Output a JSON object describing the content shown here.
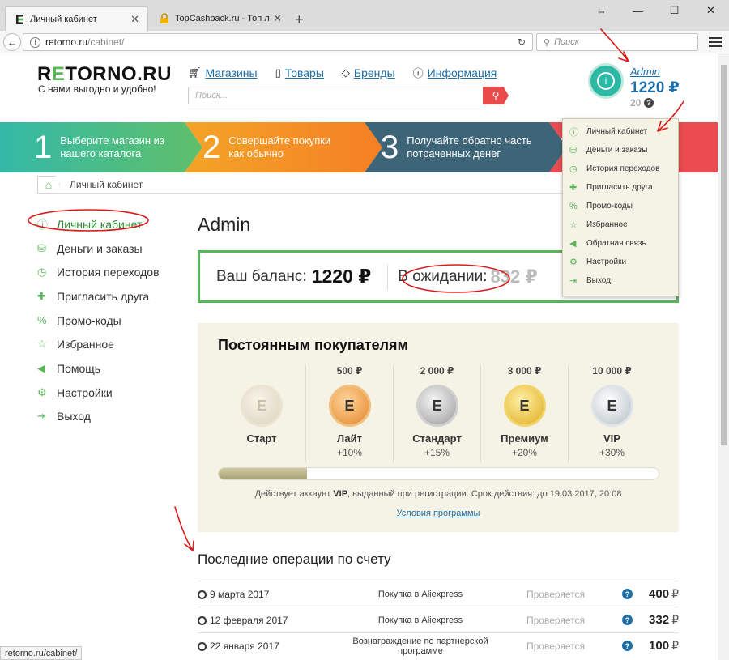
{
  "browser": {
    "tabs": [
      {
        "title": "Личный кабинет",
        "active": true
      },
      {
        "title": "TopCashback.ru - Топ лу...",
        "active": false
      }
    ],
    "new_tab": "+",
    "window": {
      "minimize": "—",
      "maximize": "☐",
      "close": "✕"
    },
    "url_host": "retorno.ru",
    "url_path": "/cabinet/",
    "search_placeholder": "Поиск",
    "status_url": "retorno.ru/cabinet/"
  },
  "header": {
    "logo_prefix": "R",
    "logo_e": "E",
    "logo_rest": "TORNO.RU",
    "slogan": "С нами выгодно и удобно!",
    "nav": [
      {
        "label": "Магазины",
        "icon": "cart-icon"
      },
      {
        "label": "Товары",
        "icon": "bag-icon"
      },
      {
        "label": "Бренды",
        "icon": "tag-icon"
      },
      {
        "label": "Информация",
        "icon": "info-icon"
      }
    ],
    "search_placeholder": "Поиск...",
    "user": {
      "name": "Admin",
      "balance": "1220 ₽",
      "pending": "20 ₽",
      "help": "?"
    }
  },
  "steps": [
    {
      "num": "1",
      "line1": "Выберите магазин из",
      "line2": "нашего каталога"
    },
    {
      "num": "2",
      "line1": "Совершайте покупки",
      "line2": "как обычно"
    },
    {
      "num": "3",
      "line1": "Получайте обратно часть",
      "line2": "потраченных денег"
    },
    {
      "num": "4",
      "line1": "",
      "line2": ""
    }
  ],
  "breadcrumb": {
    "current": "Личный кабинет"
  },
  "sidebar": {
    "items": [
      {
        "label": "Личный кабинет",
        "icon": "user-circle-icon",
        "active": true
      },
      {
        "label": "Деньги и заказы",
        "icon": "coins-icon"
      },
      {
        "label": "История переходов",
        "icon": "clock-icon"
      },
      {
        "label": "Пригласить друга",
        "icon": "user-plus-icon"
      },
      {
        "label": "Промо-коды",
        "icon": "percent-icon"
      },
      {
        "label": "Избранное",
        "icon": "star-icon"
      },
      {
        "label": "Помощь",
        "icon": "megaphone-icon"
      },
      {
        "label": "Настройки",
        "icon": "gear-icon"
      },
      {
        "label": "Выход",
        "icon": "exit-icon"
      }
    ]
  },
  "main": {
    "title": "Admin",
    "balance_label": "Ваш баланс:",
    "balance_value": "1220 ₽",
    "pending_label": "В ожидании:",
    "pending_value": "832 ₽"
  },
  "loyalty": {
    "title": "Постоянным покупателям",
    "levels": [
      {
        "threshold": "",
        "name": "Старт",
        "bonus": ""
      },
      {
        "threshold": "500 ₽",
        "name": "Лайт",
        "bonus": "+10%"
      },
      {
        "threshold": "2 000 ₽",
        "name": "Стандарт",
        "bonus": "+15%"
      },
      {
        "threshold": "3 000 ₽",
        "name": "Премиум",
        "bonus": "+20%"
      },
      {
        "threshold": "10 000 ₽",
        "name": "VIP",
        "bonus": "+30%"
      }
    ],
    "progress_fraction": 0.2,
    "note_prefix": "Действует аккаунт",
    "note_level": "VIP",
    "note_suffix": ", выданный при регистрации. Срок действия: до 19.03.2017, 20:08",
    "link": "Условия программы"
  },
  "operations": {
    "title": "Последние операции по счету",
    "rows": [
      {
        "date": "9 марта 2017",
        "desc": "Покупка в Aliexpress",
        "status": "Проверяется",
        "amount": "400",
        "currency": "₽"
      },
      {
        "date": "12 февраля 2017",
        "desc": "Покупка в Aliexpress",
        "status": "Проверяется",
        "amount": "332",
        "currency": "₽"
      },
      {
        "date": "22 января 2017",
        "desc": "Вознаграждение по партнерской программе",
        "status": "Проверяется",
        "amount": "100",
        "currency": "₽"
      }
    ]
  },
  "dropdown": {
    "items": [
      {
        "label": "Личный кабинет",
        "icon": "user-circle-icon"
      },
      {
        "label": "Деньги и заказы",
        "icon": "coins-icon"
      },
      {
        "label": "История переходов",
        "icon": "clock-icon"
      },
      {
        "label": "Пригласить друга",
        "icon": "user-plus-icon"
      },
      {
        "label": "Промо-коды",
        "icon": "percent-icon"
      },
      {
        "label": "Избранное",
        "icon": "star-icon"
      },
      {
        "label": "Обратная связь",
        "icon": "megaphone-icon"
      },
      {
        "label": "Настройки",
        "icon": "gear-icon"
      },
      {
        "label": "Выход",
        "icon": "exit-icon"
      }
    ]
  },
  "colors": {
    "accent_green": "#5bb55a",
    "link_blue": "#1f6fa8",
    "annotation_red": "#d81b1b"
  }
}
